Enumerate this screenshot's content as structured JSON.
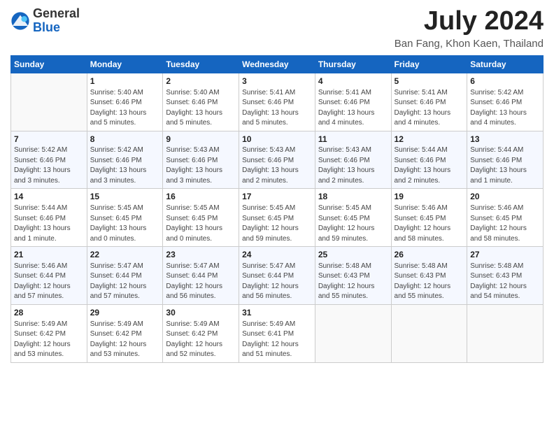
{
  "header": {
    "logo_general": "General",
    "logo_blue": "Blue",
    "month_title": "July 2024",
    "location": "Ban Fang, Khon Kaen, Thailand"
  },
  "days_of_week": [
    "Sunday",
    "Monday",
    "Tuesday",
    "Wednesday",
    "Thursday",
    "Friday",
    "Saturday"
  ],
  "weeks": [
    [
      {
        "day": "",
        "detail": ""
      },
      {
        "day": "1",
        "detail": "Sunrise: 5:40 AM\nSunset: 6:46 PM\nDaylight: 13 hours\nand 5 minutes."
      },
      {
        "day": "2",
        "detail": "Sunrise: 5:40 AM\nSunset: 6:46 PM\nDaylight: 13 hours\nand 5 minutes."
      },
      {
        "day": "3",
        "detail": "Sunrise: 5:41 AM\nSunset: 6:46 PM\nDaylight: 13 hours\nand 5 minutes."
      },
      {
        "day": "4",
        "detail": "Sunrise: 5:41 AM\nSunset: 6:46 PM\nDaylight: 13 hours\nand 4 minutes."
      },
      {
        "day": "5",
        "detail": "Sunrise: 5:41 AM\nSunset: 6:46 PM\nDaylight: 13 hours\nand 4 minutes."
      },
      {
        "day": "6",
        "detail": "Sunrise: 5:42 AM\nSunset: 6:46 PM\nDaylight: 13 hours\nand 4 minutes."
      }
    ],
    [
      {
        "day": "7",
        "detail": "Sunrise: 5:42 AM\nSunset: 6:46 PM\nDaylight: 13 hours\nand 3 minutes."
      },
      {
        "day": "8",
        "detail": "Sunrise: 5:42 AM\nSunset: 6:46 PM\nDaylight: 13 hours\nand 3 minutes."
      },
      {
        "day": "9",
        "detail": "Sunrise: 5:43 AM\nSunset: 6:46 PM\nDaylight: 13 hours\nand 3 minutes."
      },
      {
        "day": "10",
        "detail": "Sunrise: 5:43 AM\nSunset: 6:46 PM\nDaylight: 13 hours\nand 2 minutes."
      },
      {
        "day": "11",
        "detail": "Sunrise: 5:43 AM\nSunset: 6:46 PM\nDaylight: 13 hours\nand 2 minutes."
      },
      {
        "day": "12",
        "detail": "Sunrise: 5:44 AM\nSunset: 6:46 PM\nDaylight: 13 hours\nand 2 minutes."
      },
      {
        "day": "13",
        "detail": "Sunrise: 5:44 AM\nSunset: 6:46 PM\nDaylight: 13 hours\nand 1 minute."
      }
    ],
    [
      {
        "day": "14",
        "detail": "Sunrise: 5:44 AM\nSunset: 6:46 PM\nDaylight: 13 hours\nand 1 minute."
      },
      {
        "day": "15",
        "detail": "Sunrise: 5:45 AM\nSunset: 6:45 PM\nDaylight: 13 hours\nand 0 minutes."
      },
      {
        "day": "16",
        "detail": "Sunrise: 5:45 AM\nSunset: 6:45 PM\nDaylight: 13 hours\nand 0 minutes."
      },
      {
        "day": "17",
        "detail": "Sunrise: 5:45 AM\nSunset: 6:45 PM\nDaylight: 12 hours\nand 59 minutes."
      },
      {
        "day": "18",
        "detail": "Sunrise: 5:45 AM\nSunset: 6:45 PM\nDaylight: 12 hours\nand 59 minutes."
      },
      {
        "day": "19",
        "detail": "Sunrise: 5:46 AM\nSunset: 6:45 PM\nDaylight: 12 hours\nand 58 minutes."
      },
      {
        "day": "20",
        "detail": "Sunrise: 5:46 AM\nSunset: 6:45 PM\nDaylight: 12 hours\nand 58 minutes."
      }
    ],
    [
      {
        "day": "21",
        "detail": "Sunrise: 5:46 AM\nSunset: 6:44 PM\nDaylight: 12 hours\nand 57 minutes."
      },
      {
        "day": "22",
        "detail": "Sunrise: 5:47 AM\nSunset: 6:44 PM\nDaylight: 12 hours\nand 57 minutes."
      },
      {
        "day": "23",
        "detail": "Sunrise: 5:47 AM\nSunset: 6:44 PM\nDaylight: 12 hours\nand 56 minutes."
      },
      {
        "day": "24",
        "detail": "Sunrise: 5:47 AM\nSunset: 6:44 PM\nDaylight: 12 hours\nand 56 minutes."
      },
      {
        "day": "25",
        "detail": "Sunrise: 5:48 AM\nSunset: 6:43 PM\nDaylight: 12 hours\nand 55 minutes."
      },
      {
        "day": "26",
        "detail": "Sunrise: 5:48 AM\nSunset: 6:43 PM\nDaylight: 12 hours\nand 55 minutes."
      },
      {
        "day": "27",
        "detail": "Sunrise: 5:48 AM\nSunset: 6:43 PM\nDaylight: 12 hours\nand 54 minutes."
      }
    ],
    [
      {
        "day": "28",
        "detail": "Sunrise: 5:49 AM\nSunset: 6:42 PM\nDaylight: 12 hours\nand 53 minutes."
      },
      {
        "day": "29",
        "detail": "Sunrise: 5:49 AM\nSunset: 6:42 PM\nDaylight: 12 hours\nand 53 minutes."
      },
      {
        "day": "30",
        "detail": "Sunrise: 5:49 AM\nSunset: 6:42 PM\nDaylight: 12 hours\nand 52 minutes."
      },
      {
        "day": "31",
        "detail": "Sunrise: 5:49 AM\nSunset: 6:41 PM\nDaylight: 12 hours\nand 51 minutes."
      },
      {
        "day": "",
        "detail": ""
      },
      {
        "day": "",
        "detail": ""
      },
      {
        "day": "",
        "detail": ""
      }
    ]
  ]
}
